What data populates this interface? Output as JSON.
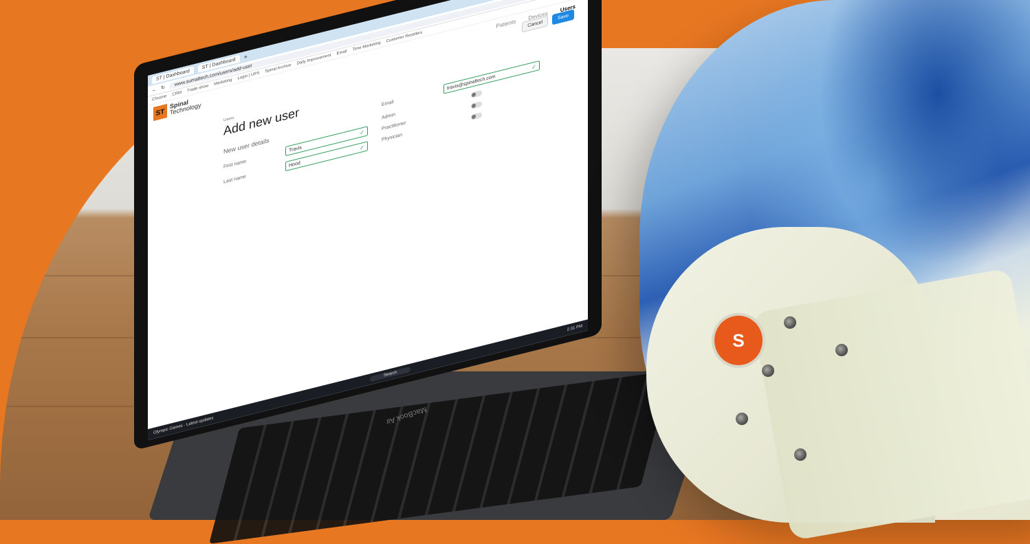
{
  "browser": {
    "tabs": [
      "ST | Dashboard",
      "ST | Dashboard"
    ],
    "url": "www.sumattech.com/users/add-user",
    "bookmarks": [
      "Chrome",
      "CRM",
      "Trade show",
      "Marketing",
      "Login | UPS",
      "Spinal Archive",
      "Daily Improvement",
      "Email",
      "Time Marketing",
      "Customer Resellers"
    ]
  },
  "app": {
    "logo_line1": "Spinal",
    "logo_line2": "Technology",
    "nav": [
      "Patients",
      "Devices",
      "Users"
    ],
    "active_nav": "Users",
    "cancel_label": "Cancel",
    "save_label": "Save",
    "breadcrumb": "Users",
    "page_title": "Add new user",
    "section_title": "New user details",
    "fields": {
      "first_name_label": "First name",
      "first_name_value": "Travis",
      "last_name_label": "Last name",
      "last_name_value": "Hood",
      "email_label": "Email",
      "email_value": "travis@spinaltech.com",
      "admin_label": "Admin",
      "practitioner_label": "Practitioner",
      "physician_label": "Physician"
    }
  },
  "taskbar": {
    "weather": "Olympic Games",
    "weather_sub": "Latest updates",
    "search": "Search",
    "time": "2:31 PM"
  },
  "laptop_brand": "MacBook Air",
  "colors": {
    "accent": "#e87722",
    "primary_button": "#1e88e5",
    "valid": "#2e9d5a"
  }
}
